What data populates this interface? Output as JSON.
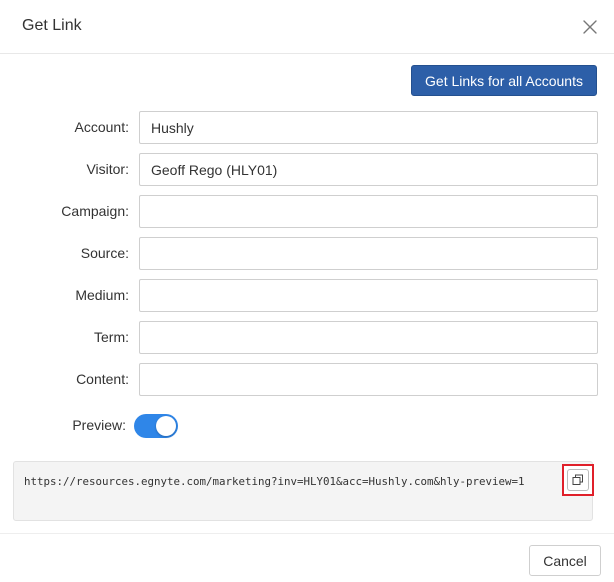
{
  "dialog": {
    "title": "Get Link",
    "close_icon": "close-x-icon"
  },
  "actions": {
    "get_links_all_label": "Get Links for all Accounts",
    "cancel_label": "Cancel"
  },
  "form": {
    "fields": [
      {
        "label": "Account:",
        "value": "Hushly"
      },
      {
        "label": "Visitor:",
        "value": "Geoff Rego (HLY01)"
      },
      {
        "label": "Campaign:",
        "value": ""
      },
      {
        "label": "Source:",
        "value": ""
      },
      {
        "label": "Medium:",
        "value": ""
      },
      {
        "label": "Term:",
        "value": ""
      },
      {
        "label": "Content:",
        "value": ""
      }
    ],
    "preview": {
      "label": "Preview:",
      "enabled": true
    }
  },
  "link": {
    "url": "https://resources.egnyte.com/marketing?inv=HLY01&acc=Hushly.com&hly-preview=1",
    "copy_icon": "copy-icon"
  },
  "colors": {
    "primary_button": "#2d5fa8",
    "toggle_on": "#2f86e8",
    "highlight_border": "#e0202a"
  }
}
